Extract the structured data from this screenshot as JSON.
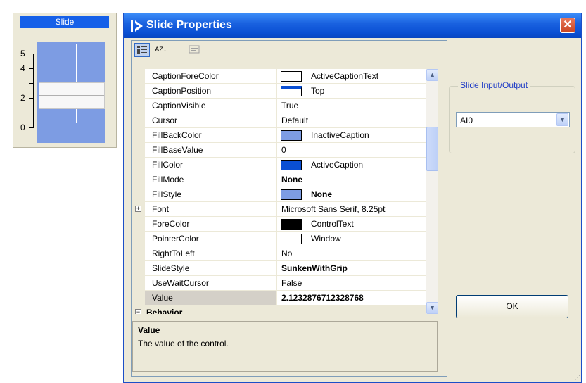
{
  "slide_control": {
    "caption": "Slide",
    "scale_labels": [
      "5",
      "4",
      "2",
      "0"
    ],
    "value": 2.1232876712328768,
    "fill_color": "#7d9ce3",
    "caption_color": "#1660e8"
  },
  "dialog": {
    "title": "Slide Properties",
    "title_icon": "play-arrow-icon",
    "close_label": "✕",
    "toolbar": {
      "categorized_icon": "categorized-view-icon",
      "alphabetical_label": "A Z ↓",
      "property_pages_icon": "property-pages-icon"
    },
    "properties": [
      {
        "name": "CaptionForeColor",
        "value": "ActiveCaptionText",
        "swatch": "#ffffff"
      },
      {
        "name": "CaptionPosition",
        "value": "Top",
        "swatch": "caption-top"
      },
      {
        "name": "CaptionVisible",
        "value": "True"
      },
      {
        "name": "Cursor",
        "value": "Default"
      },
      {
        "name": "FillBackColor",
        "value": "InactiveCaption",
        "swatch": "#7d9ce3"
      },
      {
        "name": "FillBaseValue",
        "value": "0"
      },
      {
        "name": "FillColor",
        "value": "ActiveCaption",
        "swatch": "#0a4fd3"
      },
      {
        "name": "FillMode",
        "value": "None",
        "bold": true
      },
      {
        "name": "FillStyle",
        "value": "None",
        "bold": true,
        "swatch": "#7d9ce3"
      },
      {
        "name": "Font",
        "value": "Microsoft Sans Serif, 8.25pt",
        "expandable": true
      },
      {
        "name": "ForeColor",
        "value": "ControlText",
        "swatch": "#000000"
      },
      {
        "name": "PointerColor",
        "value": "Window",
        "swatch": "#ffffff"
      },
      {
        "name": "RightToLeft",
        "value": "No"
      },
      {
        "name": "SlideStyle",
        "value": "SunkenWithGrip",
        "bold": true
      },
      {
        "name": "UseWaitCursor",
        "value": "False"
      },
      {
        "name": "Value",
        "value": "2.1232876712328768",
        "bold": true,
        "selected": true
      }
    ],
    "category_row": {
      "label": "Behavior",
      "expander": "−"
    },
    "description": {
      "title": "Value",
      "body": "The value of the control."
    },
    "io_group": {
      "title": "Slide Input/Output",
      "selected": "AI0"
    },
    "ok_label": "OK"
  }
}
